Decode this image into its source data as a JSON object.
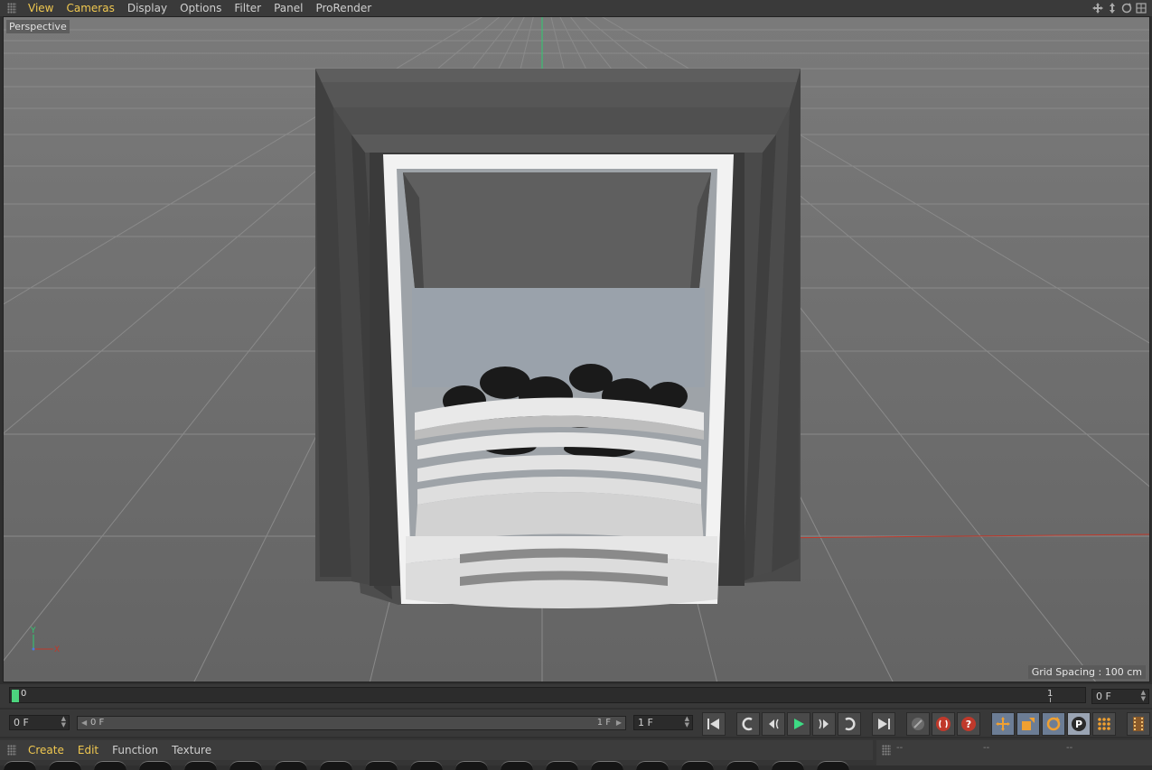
{
  "menubar": {
    "items": [
      {
        "label": "View",
        "active": true
      },
      {
        "label": "Cameras",
        "active": true
      },
      {
        "label": "Display",
        "active": false
      },
      {
        "label": "Options",
        "active": false
      },
      {
        "label": "Filter",
        "active": false
      },
      {
        "label": "Panel",
        "active": false
      },
      {
        "label": "ProRender",
        "active": false
      }
    ],
    "viewport_icons": [
      "move-view-icon",
      "zoom-view-icon",
      "rotate-view-icon",
      "toggle-layout-icon"
    ]
  },
  "viewport": {
    "camera_label": "Perspective",
    "grid_spacing": "Grid Spacing : 100 cm",
    "axis_labels": {
      "y": "Y",
      "x": "X"
    }
  },
  "timeline": {
    "start_tick": "0",
    "end_tick": "1",
    "end_field": "0 F"
  },
  "transport": {
    "current_frame": "0 F",
    "range_start": "0 F",
    "range_end": "1 F",
    "max_frame": "1 F"
  },
  "bottom_menu": {
    "items": [
      {
        "label": "Create",
        "active": true
      },
      {
        "label": "Edit",
        "active": true
      },
      {
        "label": "Function",
        "active": false
      },
      {
        "label": "Texture",
        "active": false
      }
    ]
  },
  "attributes": {
    "dash1": "--",
    "dash2": "--",
    "dash3": "--"
  },
  "colors": {
    "accent": "#f0c850",
    "playhead": "#4cd47e",
    "viewport_bg": "#6f6f6f",
    "x_axis": "#c0392b",
    "y_axis": "#2ecc71"
  }
}
